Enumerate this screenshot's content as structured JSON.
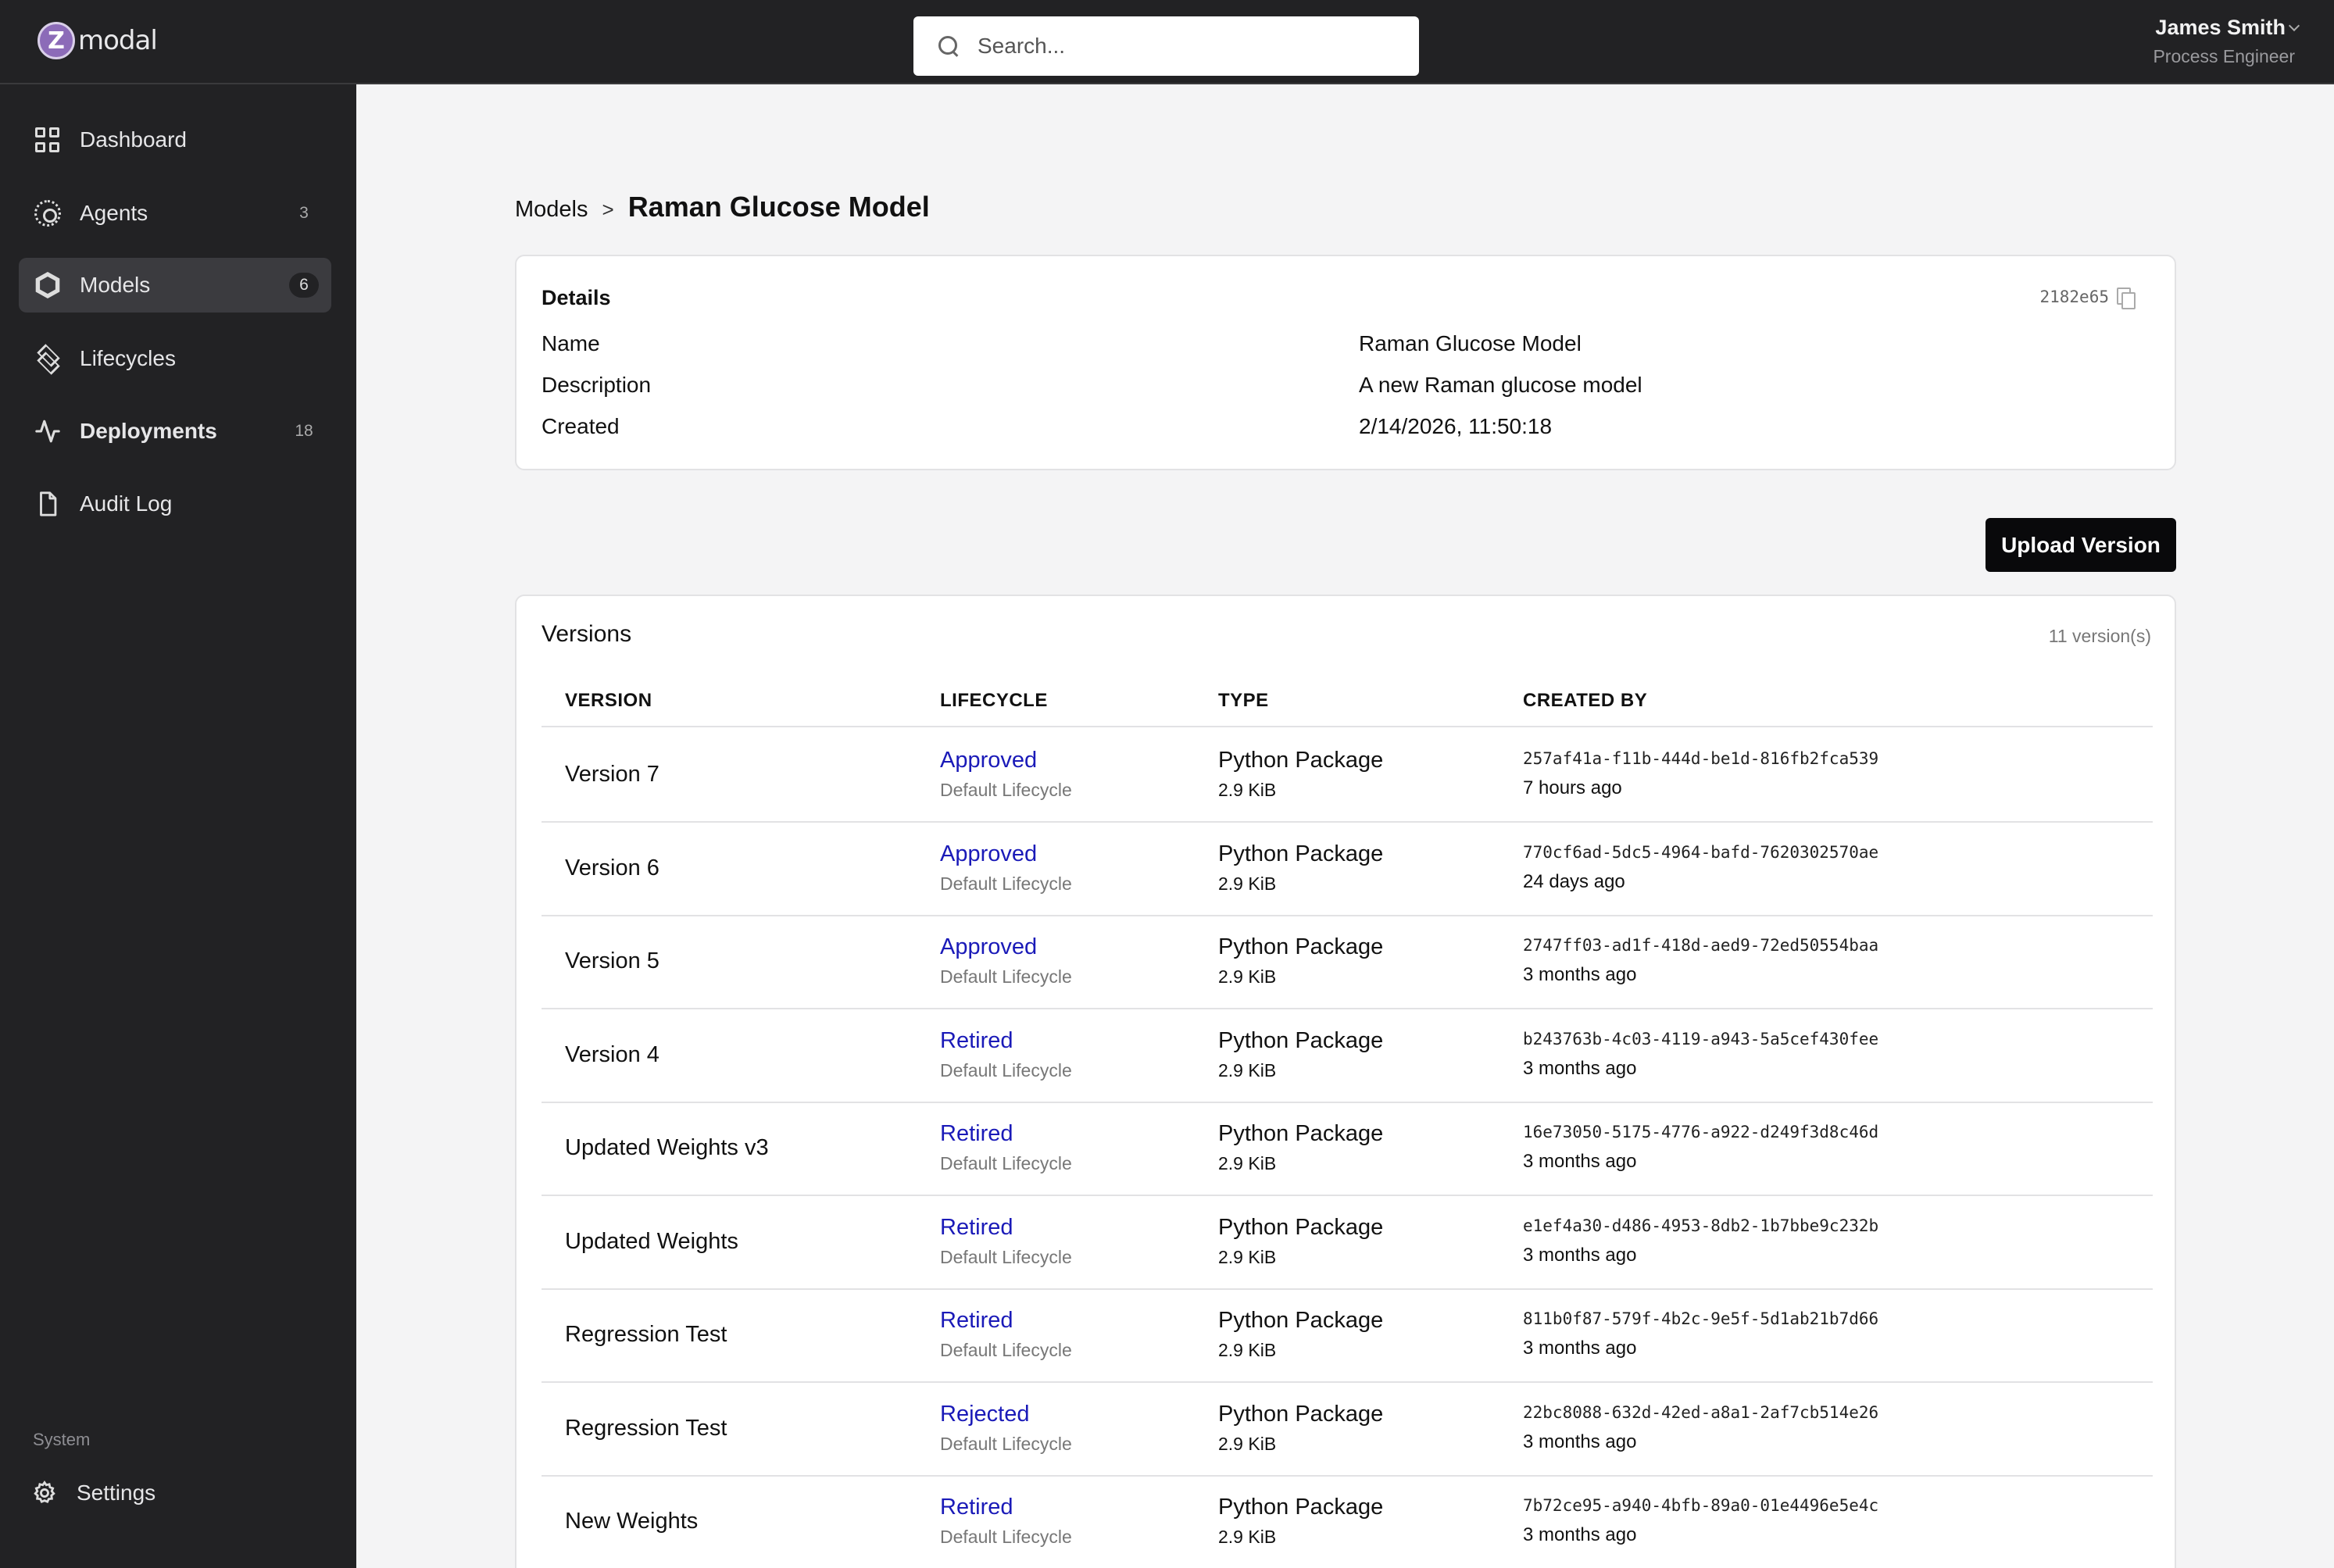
{
  "app": {
    "logo_text": "modal"
  },
  "search": {
    "placeholder": "Search..."
  },
  "user": {
    "name": "James Smith",
    "role": "Process Engineer"
  },
  "sidebar": {
    "items": [
      {
        "label": "Dashboard",
        "icon": "grid-icon",
        "badge": ""
      },
      {
        "label": "Agents",
        "icon": "agent-icon",
        "badge": "3"
      },
      {
        "label": "Models",
        "icon": "hexagon-icon",
        "badge": "6"
      },
      {
        "label": "Lifecycles",
        "icon": "layers-icon",
        "badge": ""
      },
      {
        "label": "Deployments",
        "icon": "activity-icon",
        "badge": "18"
      },
      {
        "label": "Audit Log",
        "icon": "file-icon",
        "badge": ""
      }
    ],
    "active": "Models",
    "section_label": "System",
    "settings_label": "Settings"
  },
  "breadcrumb": {
    "parent": "Models",
    "separator": ">",
    "current": "Raman Glucose Model"
  },
  "details": {
    "title": "Details",
    "id": "2182e65",
    "rows": [
      {
        "key": "Name",
        "value": "Raman Glucose Model"
      },
      {
        "key": "Description",
        "value": "A new Raman glucose model"
      },
      {
        "key": "Created",
        "value": "2/14/2026, 11:50:18"
      }
    ]
  },
  "upload_label": "Upload Version",
  "versions": {
    "title": "Versions",
    "count": "11 version(s)",
    "columns": [
      "VERSION",
      "LIFECYCLE",
      "TYPE",
      "CREATED BY"
    ],
    "rows": [
      {
        "version": "Version 7",
        "status": "Approved",
        "lifecycle": "Default Lifecycle",
        "type": "Python Package",
        "size": "2.9 KiB",
        "by": "257af41a-f11b-444d-be1d-816fb2fca539",
        "time": "7 hours ago"
      },
      {
        "version": "Version 6",
        "status": "Approved",
        "lifecycle": "Default Lifecycle",
        "type": "Python Package",
        "size": "2.9 KiB",
        "by": "770cf6ad-5dc5-4964-bafd-7620302570ae",
        "time": "24 days ago"
      },
      {
        "version": "Version 5",
        "status": "Approved",
        "lifecycle": "Default Lifecycle",
        "type": "Python Package",
        "size": "2.9 KiB",
        "by": "2747ff03-ad1f-418d-aed9-72ed50554baa",
        "time": "3 months ago"
      },
      {
        "version": "Version 4",
        "status": "Retired",
        "lifecycle": "Default Lifecycle",
        "type": "Python Package",
        "size": "2.9 KiB",
        "by": "b243763b-4c03-4119-a943-5a5cef430fee",
        "time": "3 months ago"
      },
      {
        "version": "Updated Weights v3",
        "status": "Retired",
        "lifecycle": "Default Lifecycle",
        "type": "Python Package",
        "size": "2.9 KiB",
        "by": "16e73050-5175-4776-a922-d249f3d8c46d",
        "time": "3 months ago"
      },
      {
        "version": "Updated Weights",
        "status": "Retired",
        "lifecycle": "Default Lifecycle",
        "type": "Python Package",
        "size": "2.9 KiB",
        "by": "e1ef4a30-d486-4953-8db2-1b7bbe9c232b",
        "time": "3 months ago"
      },
      {
        "version": "Regression Test",
        "status": "Retired",
        "lifecycle": "Default Lifecycle",
        "type": "Python Package",
        "size": "2.9 KiB",
        "by": "811b0f87-579f-4b2c-9e5f-5d1ab21b7d66",
        "time": "3 months ago"
      },
      {
        "version": "Regression Test",
        "status": "Rejected",
        "lifecycle": "Default Lifecycle",
        "type": "Python Package",
        "size": "2.9 KiB",
        "by": "22bc8088-632d-42ed-a8a1-2af7cb514e26",
        "time": "3 months ago"
      },
      {
        "version": "New Weights",
        "status": "Retired",
        "lifecycle": "Default Lifecycle",
        "type": "Python Package",
        "size": "2.9 KiB",
        "by": "7b72ce95-a940-4bfb-89a0-01e4496e5e4c",
        "time": "3 months ago"
      }
    ]
  },
  "colors": {
    "sidebar_bg": "#222224",
    "page_bg": "#f4f4f5",
    "link_blue": "#1a1ab8",
    "primary_button": "#09090b"
  }
}
